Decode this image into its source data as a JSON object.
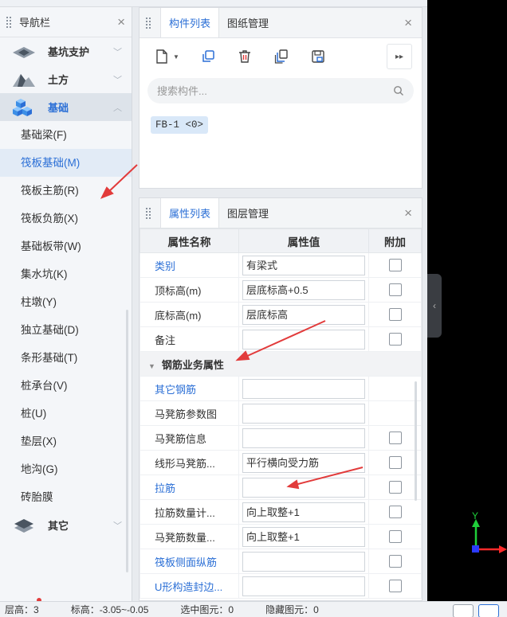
{
  "nav": {
    "title": "导航栏",
    "categories": {
      "pit": "基坑支护",
      "earth": "土方",
      "foundation": "基础",
      "other": "其它"
    },
    "items": [
      "基础梁(F)",
      "筏板基础(M)",
      "筏板主筋(R)",
      "筏板负筋(X)",
      "基础板带(W)",
      "集水坑(K)",
      "柱墩(Y)",
      "独立基础(D)",
      "条形基础(T)",
      "桩承台(V)",
      "桩(U)",
      "垫层(X)",
      "地沟(G)",
      "砖胎膜"
    ]
  },
  "component_panel": {
    "tabs": [
      "构件列表",
      "图纸管理"
    ],
    "search_placeholder": "搜索构件...",
    "components": [
      "FB-1 <0>"
    ]
  },
  "property_panel": {
    "tabs": [
      "属性列表",
      "图层管理"
    ],
    "headers": [
      "属性名称",
      "属性值",
      "附加"
    ],
    "rows": [
      {
        "name": "类别",
        "value": "有梁式"
      },
      {
        "name": "顶标高(m)",
        "value": "层底标高+0.5"
      },
      {
        "name": "底标高(m)",
        "value": "层底标高"
      },
      {
        "name": "备注",
        "value": ""
      }
    ],
    "group": "钢筋业务属性",
    "group_rows": [
      {
        "name": "其它钢筋",
        "value": ""
      },
      {
        "name": "马凳筋参数图",
        "value": ""
      },
      {
        "name": "马凳筋信息",
        "value": ""
      },
      {
        "name": "线形马凳筋...",
        "value": "平行横向受力筋"
      },
      {
        "name": "拉筋",
        "value": ""
      },
      {
        "name": "拉筋数量计...",
        "value": "向上取整+1"
      },
      {
        "name": "马凳筋数量...",
        "value": "向上取整+1"
      },
      {
        "name": "筏板侧面纵筋",
        "value": ""
      },
      {
        "name": "U形构造封边...",
        "value": ""
      }
    ]
  },
  "status": {
    "floor_height": "层高：3",
    "elevation": "标高：-3.05~-0.05",
    "selected": "选中图元：0",
    "hidden": "隐藏图元：0"
  },
  "axes": {
    "y": "Y"
  },
  "colors": {
    "accent": "#2b6fd6",
    "arrow": "#e23b3b",
    "axis_y": "#1fcf3a",
    "axis_x": "#ff2a2a"
  }
}
